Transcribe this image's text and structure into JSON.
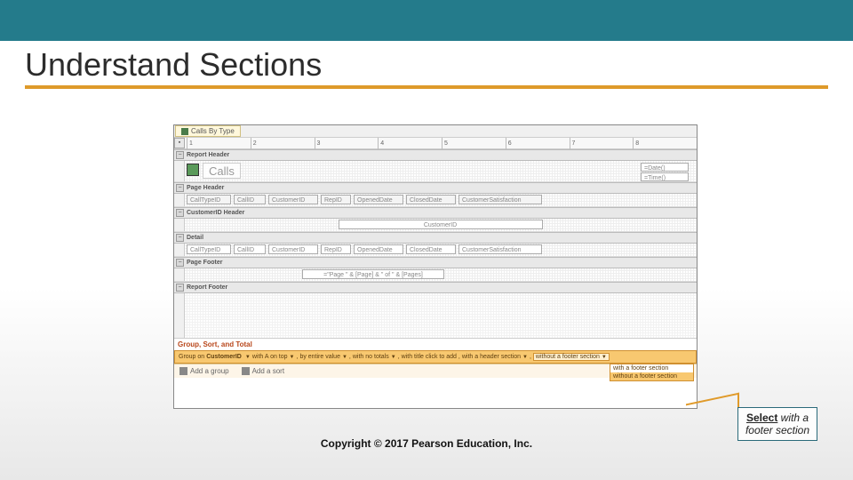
{
  "slide": {
    "title": "Understand Sections",
    "copyright": "Copyright © 2017 Pearson Education, Inc."
  },
  "callout": {
    "bold": "Select",
    "rest1": " with a footer section"
  },
  "report": {
    "tab": "Calls By Type",
    "ruler": [
      "1",
      "2",
      "3",
      "4",
      "5",
      "6",
      "7",
      "8"
    ],
    "sections": {
      "reportHeader": "Report Header",
      "pageHeader": "Page Header",
      "custHeader": "CustomerID Header",
      "detail": "Detail",
      "pageFooter": "Page Footer",
      "reportFooter": "Report Footer"
    },
    "bigLabel": "Calls",
    "dateExpr": "=Date()",
    "timeExpr": "=Time()",
    "fields": [
      "CallTypeID",
      "CallID",
      "CustomerID",
      "RepID",
      "OpenedDate",
      "ClosedDate",
      "CustomerSatisfaction"
    ],
    "custField": "CustomerID",
    "pageExpr": "=\"Page \" & [Page] & \" of \" & [Pages]"
  },
  "gst": {
    "title": "Group, Sort, and Total",
    "prefix": "Group on",
    "field": "CustomerID",
    "opts": [
      "with A on top",
      "by entire value",
      "with no totals",
      "with title click to add",
      "with a header section",
      "without a footer section"
    ],
    "dropdown": [
      "with a footer section",
      "without a footer section"
    ],
    "addGroup": "Add a group",
    "addSort": "Add a sort"
  }
}
